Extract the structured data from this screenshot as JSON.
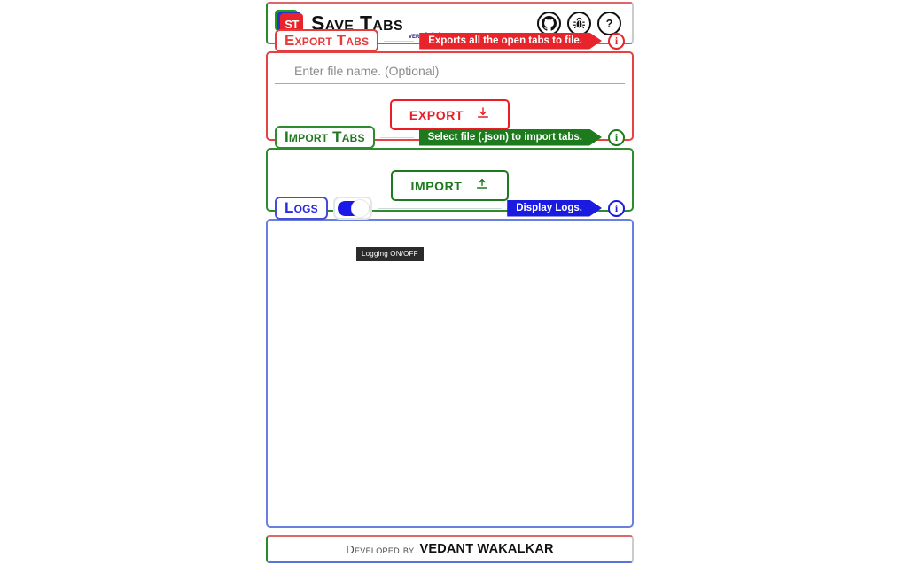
{
  "header": {
    "logo_text": "ST",
    "title": "Save Tabs",
    "version": "ver. 1.0.1",
    "icons": [
      {
        "name": "github-icon",
        "title": "GitHub"
      },
      {
        "name": "bug-icon",
        "title": "Report Bug"
      },
      {
        "name": "help-icon",
        "title": "Help"
      }
    ]
  },
  "export": {
    "legend": "Export Tabs",
    "banner": "Exports all the open tabs to file.",
    "info_glyph": "i",
    "input_placeholder": "Enter file name. (Optional)",
    "input_value": "",
    "button_label": "EXPORT",
    "button_icon": "download-icon",
    "color": "#ec1c24"
  },
  "import": {
    "legend": "Import Tabs",
    "banner": "Select file (.json) to import tabs.",
    "info_glyph": "i",
    "button_label": "IMPORT",
    "button_icon": "upload-icon",
    "color": "#1d7a1d"
  },
  "logs": {
    "legend": "Logs",
    "banner": "Display Logs.",
    "info_glyph": "i",
    "toggle_state": "on",
    "toggle_tooltip": "Logging ON/OFF",
    "content": "",
    "color": "#1a1ae0"
  },
  "footer": {
    "developed_by": "Developed by",
    "author": "VEDANT WAKALKAR"
  },
  "theme": {
    "red": "#ec1c24",
    "green": "#1d7a1d",
    "blue": "#1a1ae0",
    "frame_top": "#d66",
    "frame_left": "#2a8a2a",
    "frame_bottom": "#5a73d8"
  }
}
